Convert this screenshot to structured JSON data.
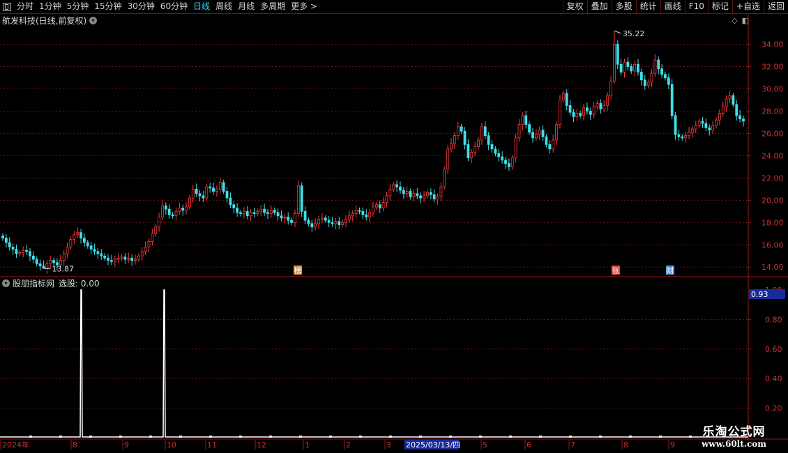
{
  "toolbar": {
    "periods": [
      "分时",
      "1分钟",
      "5分钟",
      "15分钟",
      "30分钟",
      "60分钟",
      "日线",
      "周线",
      "月线",
      "多周期",
      "更多 >"
    ],
    "active_period": "日线",
    "right_buttons": [
      "复权",
      "叠加",
      "多股",
      "统计",
      "画线",
      "F10",
      "标记",
      "+自选",
      "返回"
    ]
  },
  "main_chart": {
    "title": "航发科技(日线,前复权)",
    "high_label": "35.22",
    "low_label": "13.87",
    "y_ticks": [
      "34.00",
      "32.00",
      "30.00",
      "28.00",
      "26.00",
      "24.00",
      "22.00",
      "20.00",
      "18.00",
      "16.00",
      "14.00"
    ],
    "markers": [
      {
        "label": "榜",
        "color": "#d89048"
      },
      {
        "label": "张",
        "color": "#e04040"
      },
      {
        "label": "财",
        "color": "#4a90d9"
      }
    ]
  },
  "indicator": {
    "name": "股朋指标网",
    "value_text": "选股: 0.00",
    "y_ticks": [
      "0.80",
      "0.60",
      "0.40",
      "0.20"
    ],
    "top_tick": "1.00",
    "cursor_value": "0.93"
  },
  "chart_data": {
    "type": "candlestick",
    "ylim": [
      13.2,
      35.6
    ],
    "high": 35.22,
    "low": 13.87,
    "closes": [
      16.6,
      16.2,
      15.8,
      15.6,
      15.2,
      15.3,
      15.5,
      15.4,
      15.0,
      14.7,
      14.3,
      14.1,
      13.9,
      14.3,
      14.6,
      14.4,
      14.2,
      14.6,
      15.2,
      15.8,
      16.5,
      16.9,
      17.1,
      16.6,
      16.2,
      15.9,
      15.6,
      15.4,
      15.2,
      15.0,
      14.8,
      14.6,
      14.5,
      14.7,
      14.8,
      14.9,
      14.7,
      14.8,
      14.6,
      14.7,
      15.0,
      15.4,
      15.8,
      16.3,
      17.0,
      17.6,
      18.5,
      19.5,
      19.2,
      18.7,
      18.6,
      19.0,
      19.3,
      19.1,
      19.4,
      20.2,
      21.0,
      20.6,
      20.4,
      20.2,
      21.2,
      21.1,
      20.8,
      21.0,
      21.6,
      20.8,
      20.2,
      19.6,
      19.3,
      18.9,
      18.8,
      19.0,
      18.6,
      18.9,
      18.8,
      19.0,
      19.2,
      18.9,
      18.8,
      19.1,
      18.9,
      18.6,
      18.4,
      18.5,
      18.2,
      18.0,
      18.8,
      21.3,
      19.0,
      18.2,
      17.9,
      17.6,
      17.9,
      18.3,
      18.4,
      18.2,
      18.0,
      17.9,
      18.1,
      17.8,
      18.0,
      18.3,
      18.6,
      18.8,
      19.1,
      19.0,
      18.7,
      18.5,
      18.9,
      19.4,
      19.6,
      19.3,
      19.8,
      20.4,
      21.0,
      21.4,
      21.2,
      20.9,
      20.6,
      20.8,
      20.3,
      20.6,
      20.4,
      20.2,
      20.4,
      20.7,
      20.5,
      20.1,
      20.3,
      21.2,
      22.8,
      24.6,
      25.1,
      25.8,
      26.6,
      26.2,
      25.0,
      23.8,
      24.3,
      24.8,
      25.4,
      26.6,
      25.8,
      25.0,
      24.6,
      24.2,
      23.9,
      23.6,
      23.3,
      23.0,
      23.8,
      25.6,
      26.8,
      27.6,
      26.8,
      26.1,
      25.6,
      25.9,
      26.3,
      25.7,
      25.0,
      24.6,
      25.4,
      26.8,
      29.0,
      29.6,
      28.5,
      27.9,
      27.5,
      27.8,
      27.6,
      28.3,
      28.0,
      27.7,
      28.4,
      28.7,
      28.2,
      28.5,
      29.4,
      30.7,
      34.0,
      32.2,
      31.5,
      32.4,
      32.0,
      31.6,
      32.2,
      31.5,
      30.8,
      30.3,
      30.6,
      31.4,
      32.6,
      31.8,
      31.3,
      31.0,
      30.4,
      27.6,
      25.9,
      25.7,
      25.6,
      25.8,
      26.1,
      26.4,
      26.7,
      27.1,
      26.9,
      26.5,
      26.3,
      26.7,
      27.2,
      27.8,
      28.4,
      29.1,
      29.4,
      28.6,
      27.6,
      27.3,
      27.1
    ],
    "signal_days": [
      [
        115,
        118
      ],
      [
        234,
        237
      ]
    ],
    "indicator_ylim": [
      0,
      1.0
    ],
    "x_ticks": [
      "2024年",
      "8",
      "9",
      "10",
      "11",
      "12",
      "1",
      "2",
      "3",
      "2025/03/13/四",
      "5",
      "6",
      "7",
      "8",
      "9"
    ]
  }
}
